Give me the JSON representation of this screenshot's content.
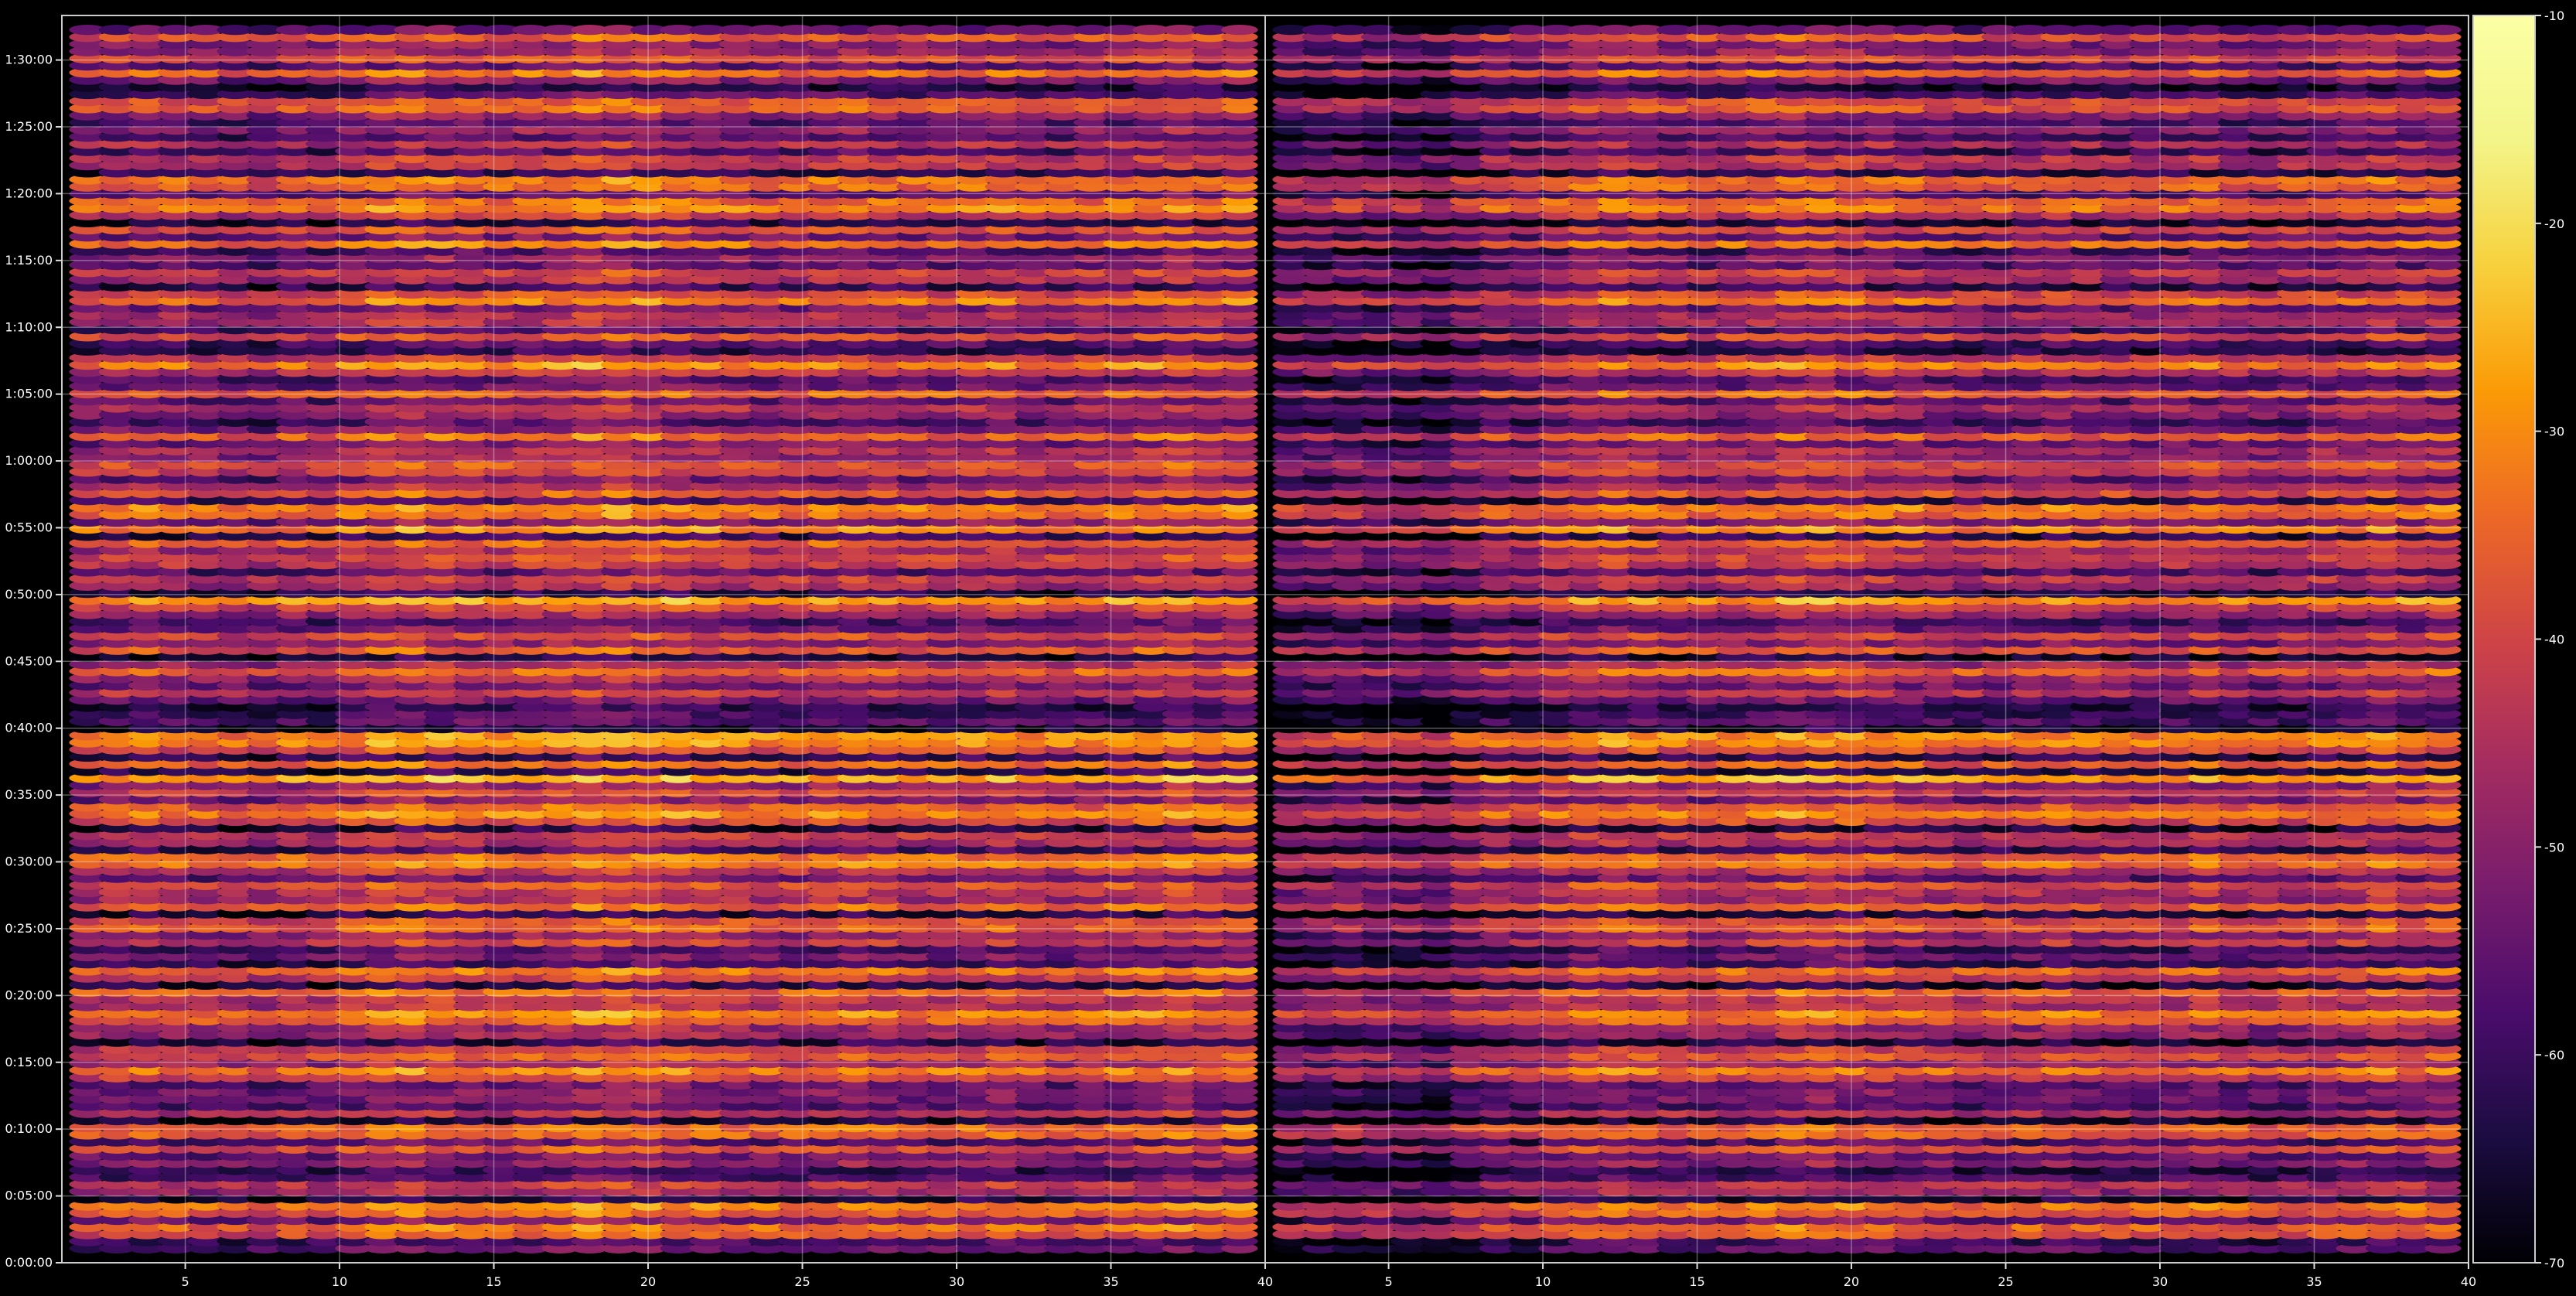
{
  "chart_data": {
    "type": "heatmap",
    "title": "",
    "xlabel": "",
    "ylabel": "",
    "panels": [
      {
        "name": "left",
        "xlim": [
          1,
          40
        ],
        "x_ticks": [
          5,
          10,
          15,
          20,
          25,
          30,
          35,
          40
        ],
        "ylim_seconds": [
          0,
          5600
        ]
      },
      {
        "name": "right",
        "xlim": [
          1,
          40
        ],
        "x_ticks": [
          5,
          10,
          15,
          20,
          25,
          30,
          35,
          40
        ],
        "ylim_seconds": [
          0,
          5600
        ]
      }
    ],
    "y_tick_labels": [
      "0:00:00",
      "0:05:00",
      "0:10:00",
      "0:15:00",
      "0:20:00",
      "0:25:00",
      "0:30:00",
      "0:35:00",
      "0:40:00",
      "0:45:00",
      "0:50:00",
      "0:55:00",
      "1:00:00",
      "1:05:00",
      "1:10:00",
      "1:15:00",
      "1:20:00",
      "1:25:00",
      "1:30:00"
    ],
    "colorbar": {
      "colormap": "inferno",
      "range": [
        -70,
        -10
      ],
      "ticks": [
        -70,
        -60,
        -50,
        -40,
        -30,
        -20,
        -10
      ]
    },
    "grid": true,
    "row_levels": [
      -58,
      -62,
      -40,
      -36,
      -55,
      -38,
      -34,
      -66,
      -50,
      -45,
      -60,
      -64,
      -52,
      -56,
      -41,
      -60,
      -38,
      -37,
      -68,
      -47,
      -60,
      -55,
      -54,
      -58,
      -43,
      -34,
      -50,
      -39,
      -45,
      -66,
      -50,
      -51,
      -38,
      -33,
      -47,
      -46,
      -37,
      -66,
      -44,
      -36,
      -62,
      -55,
      -61,
      -44,
      -52,
      -38,
      -41,
      -66,
      -37,
      -49,
      -46,
      -40,
      -57,
      -46,
      -34,
      -36,
      -62,
      -48,
      -45,
      -67,
      -41,
      -33,
      -38,
      -55,
      -43,
      -52,
      -29,
      -65,
      -37,
      -64,
      -41,
      -32,
      -32,
      -68,
      -59,
      -62,
      -65,
      -56,
      -45,
      -55,
      -49,
      -37,
      -48,
      -67,
      -39,
      -53,
      -42,
      -56,
      -61,
      -50,
      -43,
      -30,
      -66,
      -49,
      -44,
      -59,
      -45,
      -42,
      -49,
      -38,
      -64,
      -33,
      -53,
      -36,
      -33,
      -62,
      -39,
      -49,
      -57,
      -44,
      -40,
      -51,
      -48,
      -55,
      -37,
      -54,
      -61,
      -52,
      -47,
      -58,
      -37,
      -56,
      -60,
      -46,
      -33,
      -45,
      -65,
      -60,
      -41,
      -61,
      -48,
      -48,
      -56,
      -35,
      -42,
      -64,
      -48,
      -43,
      -58,
      -52,
      -61,
      -35,
      -56,
      -41,
      -66,
      -46,
      -34,
      -37,
      -58,
      -37,
      -36,
      -64,
      -46,
      -45,
      -61,
      -47,
      -60,
      -52,
      -60,
      -52,
      -39,
      -40,
      -60,
      -67,
      -54,
      -36,
      -59,
      -41,
      -51,
      -53,
      -39,
      -57
    ],
    "column_offsets": [
      0,
      1,
      2,
      1,
      0,
      -1,
      -2,
      1,
      0,
      3,
      5,
      6,
      5,
      4,
      3,
      4,
      5,
      7,
      7,
      6,
      5,
      4,
      3,
      2,
      2,
      3,
      4,
      3,
      2,
      2,
      3,
      4,
      2,
      1,
      2,
      3,
      4,
      6,
      4,
      5
    ]
  }
}
